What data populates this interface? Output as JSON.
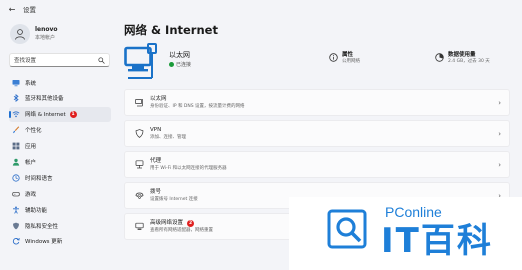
{
  "window": {
    "title": "设置"
  },
  "profile": {
    "name": "lenovo",
    "account_type": "本地帐户"
  },
  "search": {
    "text": "查找设置"
  },
  "sidebar": {
    "items": [
      {
        "label": "系统",
        "icon": "monitor-icon",
        "active": false
      },
      {
        "label": "蓝牙和其他设备",
        "icon": "bluetooth-icon",
        "active": false
      },
      {
        "label": "网络 & Internet",
        "icon": "network-icon",
        "active": true,
        "marker": "1"
      },
      {
        "label": "个性化",
        "icon": "brush-icon",
        "active": false
      },
      {
        "label": "应用",
        "icon": "apps-icon",
        "active": false
      },
      {
        "label": "帐户",
        "icon": "person-icon",
        "active": false
      },
      {
        "label": "时间和语言",
        "icon": "clock-globe-icon",
        "active": false
      },
      {
        "label": "游戏",
        "icon": "gamepad-icon",
        "active": false
      },
      {
        "label": "辅助功能",
        "icon": "accessibility-icon",
        "active": false
      },
      {
        "label": "隐私和安全性",
        "icon": "shield-icon",
        "active": false
      },
      {
        "label": "Windows 更新",
        "icon": "update-icon",
        "active": false
      }
    ]
  },
  "main": {
    "title": "网络 & Internet",
    "hero": {
      "name": "以太网",
      "status": "已连接",
      "properties": {
        "title": "属性",
        "subtitle": "公用网络"
      },
      "data_usage": {
        "title": "数据使用量",
        "subtitle": "2.4 GB，过去 30 天"
      }
    },
    "cards": [
      {
        "title": "以太网",
        "subtitle": "身份验证、IP 和 DNS 设置，按流量计费的网络",
        "icon": "ethernet-icon"
      },
      {
        "title": "VPN",
        "subtitle": "添加、连接、管理",
        "icon": "vpn-shield-icon"
      },
      {
        "title": "代理",
        "subtitle": "用于 Wi-Fi 和以太网连接的代理服务器",
        "icon": "proxy-icon"
      },
      {
        "title": "拨号",
        "subtitle": "设置拨号 Internet 连接",
        "icon": "dialup-icon"
      },
      {
        "title": "高级网络设置",
        "subtitle": "查看所有网络适配器，网络重置",
        "icon": "adapter-icon",
        "marker": "2"
      }
    ]
  },
  "watermark": {
    "brand": "PConline",
    "chinese": "IT百科"
  },
  "colors": {
    "accent": "#1e6fd0",
    "connected": "#1a9a3a",
    "marker": "#e02020",
    "watermark": "#1e7fd8"
  }
}
